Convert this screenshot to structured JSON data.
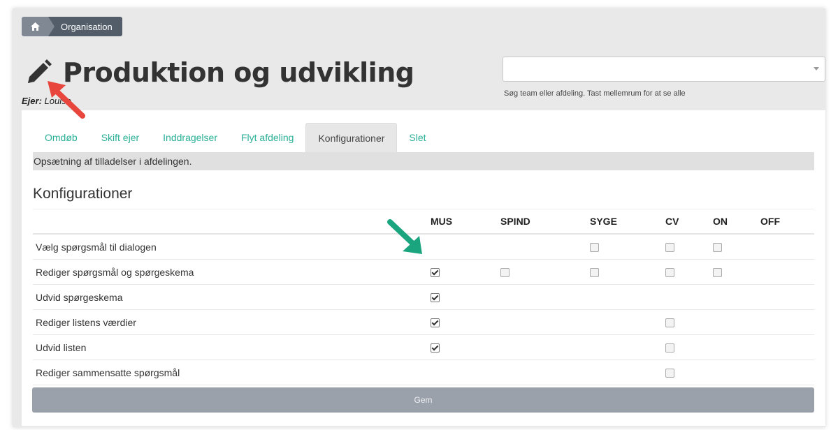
{
  "breadcrumb": {
    "home_icon": "home-icon",
    "current": "Organisation"
  },
  "header": {
    "title": "Produktion og udvikling",
    "owner_label": "Ejer:",
    "owner_value": "Louise",
    "edit_icon": "pencil-icon"
  },
  "search": {
    "value": "",
    "help_text": "Søg team eller afdeling. Tast mellemrum for at se alle"
  },
  "tabs": [
    {
      "label": "Omdøb"
    },
    {
      "label": "Skift ejer"
    },
    {
      "label": "Inddragelser"
    },
    {
      "label": "Flyt afdeling"
    },
    {
      "label": "Konfigurationer"
    },
    {
      "label": "Slet"
    }
  ],
  "active_tab_description": "Opsætning af tilladelser i afdelingen.",
  "section_title": "Konfigurationer",
  "table": {
    "columns": [
      "MUS",
      "SPIND",
      "SYGE",
      "CV",
      "ON",
      "OFF"
    ],
    "rows": [
      {
        "label": "Vælg spørgsmål til dialogen",
        "cells": [
          null,
          null,
          false,
          false,
          false,
          null
        ]
      },
      {
        "label": "Rediger spørgsmål og spørgeskema",
        "cells": [
          true,
          false,
          false,
          false,
          false,
          null
        ]
      },
      {
        "label": "Udvid spørgeskema",
        "cells": [
          true,
          null,
          null,
          null,
          null,
          null
        ]
      },
      {
        "label": "Rediger listens værdier",
        "cells": [
          true,
          null,
          null,
          false,
          null,
          null
        ]
      },
      {
        "label": "Udvid listen",
        "cells": [
          true,
          null,
          null,
          false,
          null,
          null
        ]
      },
      {
        "label": "Rediger sammensatte spørgsmål",
        "cells": [
          null,
          null,
          null,
          false,
          null,
          null
        ]
      }
    ]
  },
  "save_button": "Gem",
  "colors": {
    "tab_link": "#2bb097",
    "breadcrumb": "#525d69",
    "save_button": "#9aa1ab",
    "annotation_red": "#e8453c",
    "annotation_green": "#1aa57f"
  }
}
